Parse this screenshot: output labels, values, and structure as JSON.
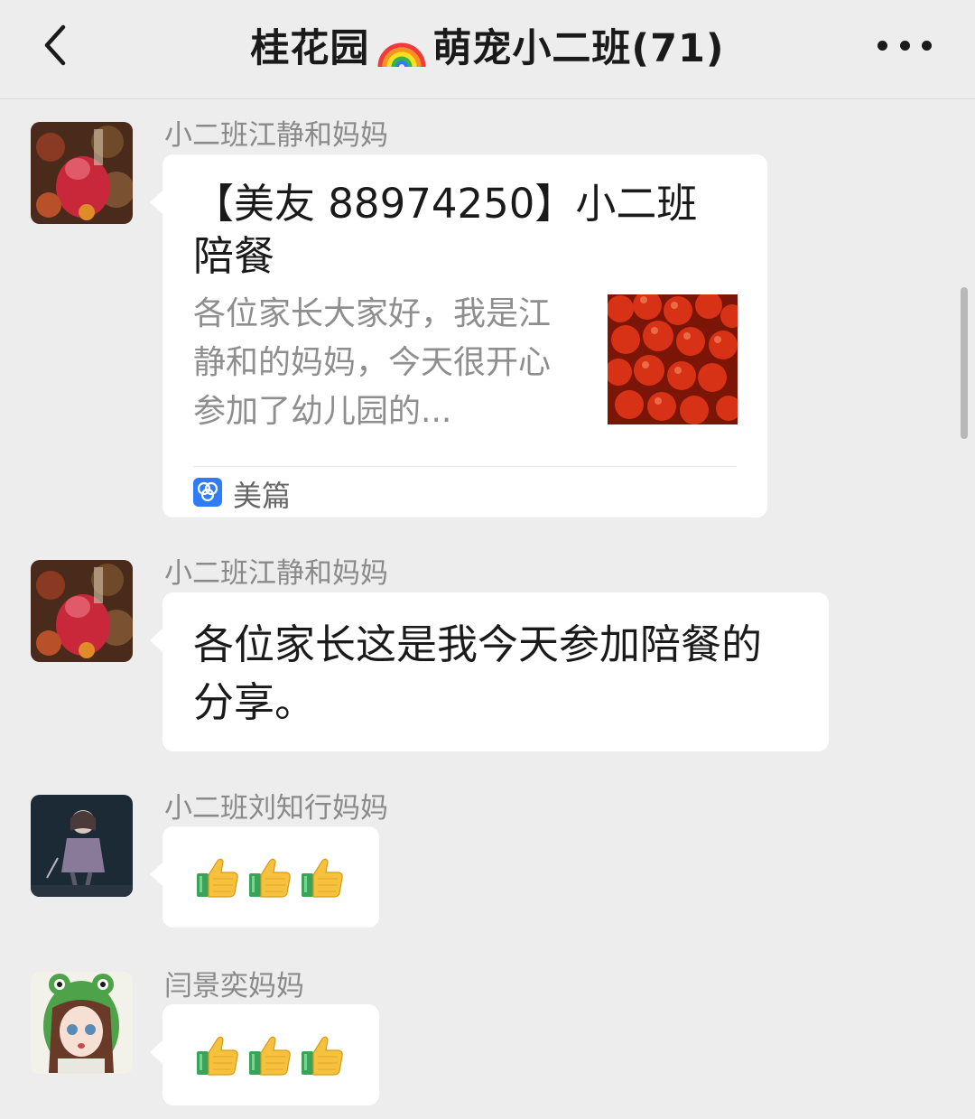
{
  "header": {
    "title_prefix": "桂花园",
    "title_suffix": "萌宠小二班(71)"
  },
  "icons": {
    "back": "chevron-left-icon",
    "more": "more-icon",
    "rainbow": "rainbow-emoji",
    "thumbs": "thumbs-up-emoji",
    "source": "meipian-logo-icon"
  },
  "messages": [
    {
      "sender": "小二班江静和妈妈",
      "type": "link-card",
      "card": {
        "title": "【美友 88974250】小二班陪餐",
        "description": "各位家长大家好，我是江静和的妈妈，今天很开心参加了幼儿园的...",
        "source": "美篇"
      }
    },
    {
      "sender": "小二班江静和妈妈",
      "type": "text",
      "text": "各位家长这是我今天参加陪餐的分享。"
    },
    {
      "sender": "小二班刘知行妈妈",
      "type": "emoji",
      "count": 3
    },
    {
      "sender": "闫景奕妈妈",
      "type": "emoji",
      "count": 3
    }
  ],
  "colors": {
    "background": "#ededed",
    "bubble": "#ffffff",
    "sender_text": "#8a8a8a",
    "title_text": "#1a1a1a",
    "source_icon": "#2f7cf6"
  }
}
